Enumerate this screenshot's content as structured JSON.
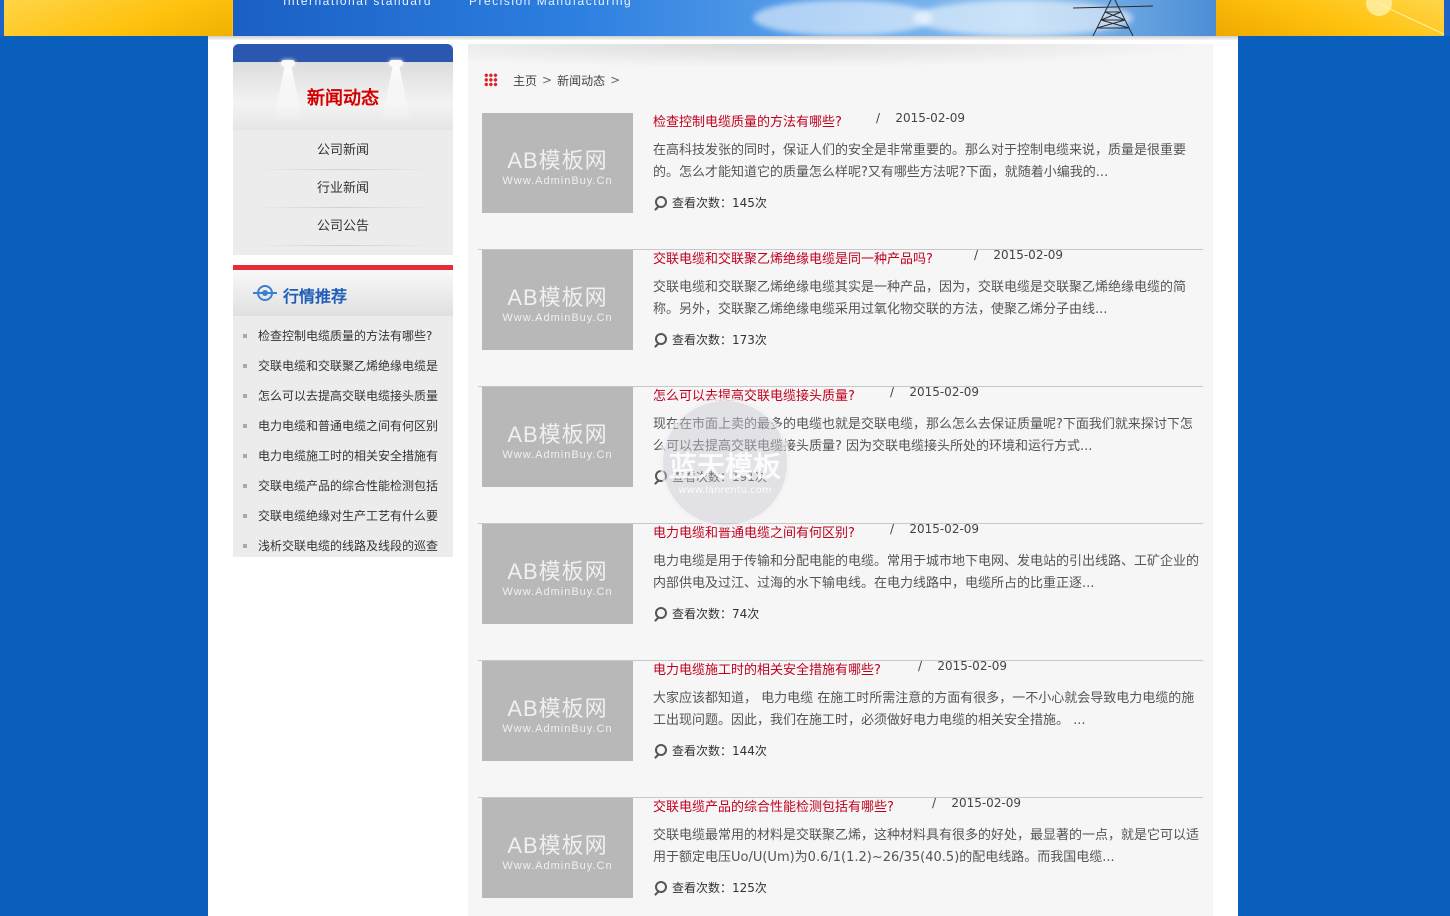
{
  "banner": {
    "slogan_left": "International standard",
    "slogan_right": "Precision Manufacturing"
  },
  "sidebar_news": {
    "title": "新闻动态",
    "items": [
      {
        "label": "公司新闻"
      },
      {
        "label": "行业新闻"
      },
      {
        "label": "公司公告"
      }
    ]
  },
  "sidebar_hot": {
    "title": "行情推荐",
    "items": [
      {
        "label": "检查控制电缆质量的方法有哪些?"
      },
      {
        "label": "交联电缆和交联聚乙烯绝缘电缆是"
      },
      {
        "label": "怎么可以去提高交联电缆接头质量"
      },
      {
        "label": "电力电缆和普通电缆之间有何区别"
      },
      {
        "label": "电力电缆施工时的相关安全措施有"
      },
      {
        "label": "交联电缆产品的综合性能检测包括"
      },
      {
        "label": "交联电缆绝缘对生产工艺有什么要"
      },
      {
        "label": "浅析交联电缆的线路及线段的巡查"
      }
    ]
  },
  "breadcrumb": {
    "home": "主页",
    "sep": ">",
    "current": "新闻动态"
  },
  "thumb": {
    "line1": "AB模板网",
    "line2": "Www.AdminBuy.Cn"
  },
  "articles": [
    {
      "title": "检查控制电缆质量的方法有哪些?",
      "slash": "/",
      "date": "2015-02-09",
      "desc": "在高科技发张的同时，保证人们的安全是非常重要的。那么对于控制电缆来说，质量是很重要的。怎么才能知道它的质量怎么样呢?又有哪些方法呢?下面，就随着小编我的...",
      "views": "查看次数：145次"
    },
    {
      "title": "交联电缆和交联聚乙烯绝缘电缆是同一种产品吗?",
      "slash": "/",
      "date": "2015-02-09",
      "desc": "交联电缆和交联聚乙烯绝缘电缆其实是一种产品，因为，交联电缆是交联聚乙烯绝缘电缆的简称。另外，交联聚乙烯绝缘电缆采用过氧化物交联的方法，使聚乙烯分子由线...",
      "views": "查看次数：173次"
    },
    {
      "title": "怎么可以去提高交联电缆接头质量?",
      "slash": "/",
      "date": "2015-02-09",
      "desc": "现在在市面上卖的最多的电缆也就是交联电缆，那么怎么去保证质量呢?下面我们就来探讨下怎么可以去提高交联电缆接头质量? 因为交联电缆接头所处的环境和运行方式...",
      "views": "查看次数：191次"
    },
    {
      "title": "电力电缆和普通电缆之间有何区别?",
      "slash": "/",
      "date": "2015-02-09",
      "desc": "电力电缆是用于传输和分配电能的电缆。常用于城市地下电网、发电站的引出线路、工矿企业的内部供电及过江、过海的水下输电线。在电力线路中，电缆所占的比重正逐...",
      "views": "查看次数：74次"
    },
    {
      "title": "电力电缆施工时的相关安全措施有哪些?",
      "slash": "/",
      "date": "2015-02-09",
      "desc": "大家应该都知道， 电力电缆 在施工时所需注意的方面有很多，一不小心就会导致电力电缆的施工出现问题。因此，我们在施工时，必须做好电力电缆的相关安全措施。 ...",
      "views": "查看次数：144次"
    },
    {
      "title": "交联电缆产品的综合性能检测包括有哪些?",
      "slash": "/",
      "date": "2015-02-09",
      "desc": "交联电缆最常用的材料是交联聚乙烯，这种材料具有很多的好处，最显著的一点，就是它可以适用于额定电压Uo/U(Um)为0.6/1(1.2)~26/35(40.5)的配电线路。而我国电缆...",
      "views": "查看次数：125次"
    }
  ],
  "watermark": {
    "line1": "蓝天模板",
    "line2": "www.lanrentu.com"
  },
  "colors": {
    "page_bg": "#0a5fbd",
    "banner_yellow": "#ffc20e",
    "title_red": "#c1001f",
    "accent_blue": "#1f5db8"
  }
}
